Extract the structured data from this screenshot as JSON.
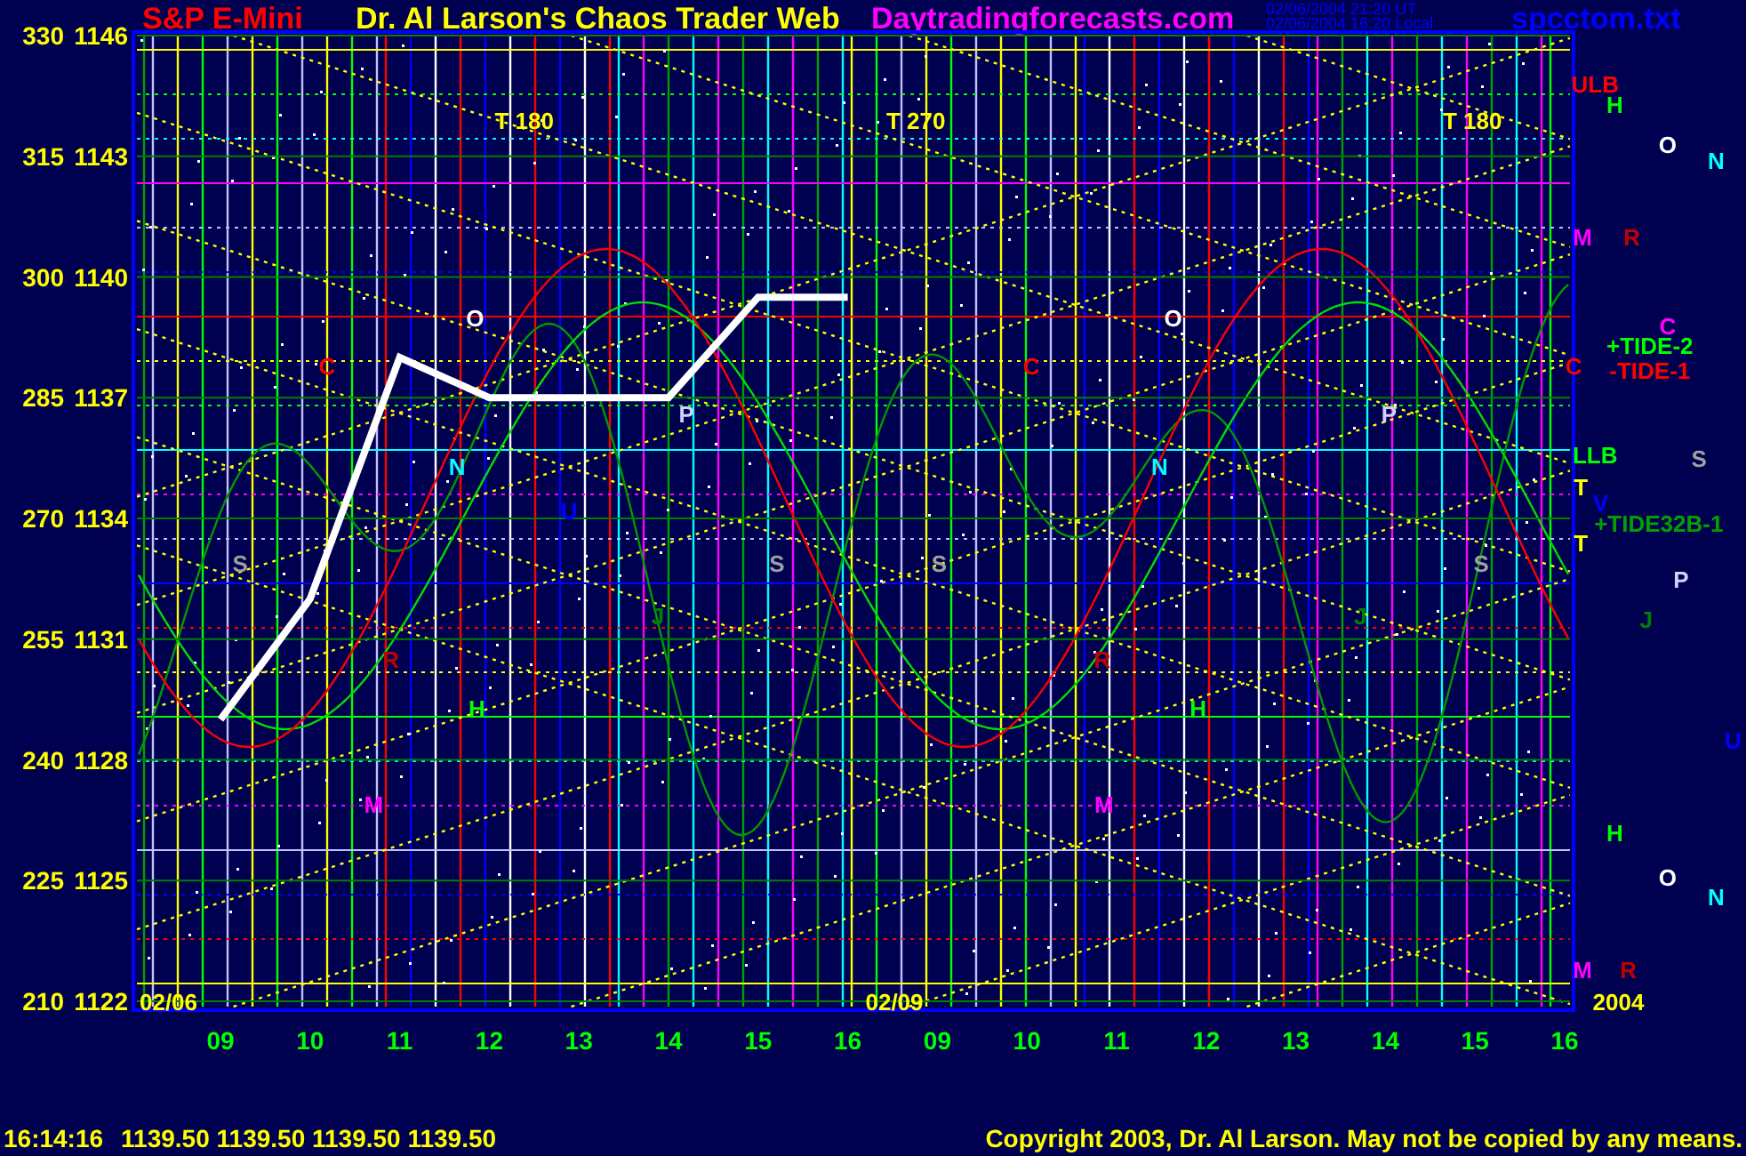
{
  "header": {
    "site_title": "Dr. Al Larson's Chaos Trader Web",
    "site_url": "Daytradingforecasts.com",
    "timestamps": [
      "02/06/2004 21:20 UT",
      "02/06/2004 16:20 Local"
    ],
    "file_name": "spcctom.txt"
  },
  "chart": {
    "chart_data": {
      "type": "line",
      "categories": [
        "09",
        "10",
        "11",
        "12",
        "13",
        "14",
        "15",
        "16",
        "09",
        "10",
        "11",
        "12",
        "13",
        "14",
        "15",
        "16"
      ],
      "yticks": [
        1146,
        1143,
        1140,
        1137,
        1134,
        1131,
        1128,
        1125,
        1122
      ],
      "ylim": [
        1122,
        1146
      ],
      "grid": true,
      "series": [
        {
          "name": "S&P E-Mini",
          "color": "#ffffff",
          "values": [
            1129,
            1132,
            1138,
            1137,
            1137,
            1137,
            1139.5,
            1139.5,
            null,
            null,
            null,
            null,
            null,
            null,
            null,
            null
          ]
        }
      ]
    },
    "left_scale": [
      "330",
      "315",
      "300",
      "285",
      "270",
      "255",
      "240",
      "225",
      "210"
    ],
    "markers": [
      {
        "text": "T 180",
        "color": "#ffff00"
      },
      {
        "text": "T 270",
        "color": "#ffff00"
      },
      {
        "text": "T 180",
        "color": "#ffff00"
      },
      {
        "text": "O",
        "color": "#ffffff"
      },
      {
        "text": "O",
        "color": "#ffffff"
      },
      {
        "text": "C",
        "color": "#ff0000"
      },
      {
        "text": "C",
        "color": "#ff0000"
      },
      {
        "text": "N",
        "color": "#00ffff"
      },
      {
        "text": "N",
        "color": "#00ffff"
      },
      {
        "text": "P",
        "color": "#d0d0ff"
      },
      {
        "text": "P",
        "color": "#d0d0ff"
      },
      {
        "text": "U",
        "color": "#0000ff"
      },
      {
        "text": "S",
        "color": "#a0a0a0"
      },
      {
        "text": "S",
        "color": "#a0a0a0"
      },
      {
        "text": "S",
        "color": "#a0a0a0"
      },
      {
        "text": "S",
        "color": "#a0a0a0"
      },
      {
        "text": "J",
        "color": "#008000"
      },
      {
        "text": "J",
        "color": "#008000"
      },
      {
        "text": "R",
        "color": "#c00000"
      },
      {
        "text": "R",
        "color": "#c00000"
      },
      {
        "text": "H",
        "color": "#00ff00"
      },
      {
        "text": "H",
        "color": "#00ff00"
      },
      {
        "text": "M",
        "color": "#ff00ff"
      },
      {
        "text": "M",
        "color": "#ff00ff"
      },
      {
        "text": "02/06",
        "color": "#ffff00"
      },
      {
        "text": "02/09",
        "color": "#ffff00"
      },
      {
        "text": "2004",
        "color": "#ffff00"
      },
      {
        "text": "ULB",
        "color": "#ff0000"
      },
      {
        "text": "H",
        "color": "#00ff00"
      },
      {
        "text": "O",
        "color": "#ffffff"
      },
      {
        "text": "N",
        "color": "#00ffff"
      },
      {
        "text": "M",
        "color": "#ff00ff"
      },
      {
        "text": "R",
        "color": "#c00000"
      },
      {
        "text": "C",
        "color": "#ff00ff"
      },
      {
        "text": "+TIDE-2",
        "color": "#00ff00"
      },
      {
        "text": "C",
        "color": "#ff0000"
      },
      {
        "text": "-TIDE-1",
        "color": "#ff0000"
      },
      {
        "text": "LLB",
        "color": "#00ff00"
      },
      {
        "text": "S",
        "color": "#a0a0a0"
      },
      {
        "text": "T",
        "color": "#ffff00"
      },
      {
        "text": "V",
        "color": "#0000ff"
      },
      {
        "text": "+TIDE32B-1",
        "color": "#00a000"
      },
      {
        "text": "T",
        "color": "#ffff00"
      },
      {
        "text": "P",
        "color": "#d0d0ff"
      },
      {
        "text": "J",
        "color": "#008000"
      },
      {
        "text": "U",
        "color": "#0000ff"
      },
      {
        "text": "H",
        "color": "#00ff00"
      },
      {
        "text": "O",
        "color": "#ffffff"
      },
      {
        "text": "N",
        "color": "#00ffff"
      },
      {
        "text": "M",
        "color": "#ff00ff"
      },
      {
        "text": "R",
        "color": "#c00000"
      }
    ]
  },
  "footer": {
    "time": "16:14:16",
    "prices": "1139.50 1139.50 1139.50 1139.50",
    "copyright": "Copyright 2003, Dr. Al Larson. May not be copied by any means."
  }
}
